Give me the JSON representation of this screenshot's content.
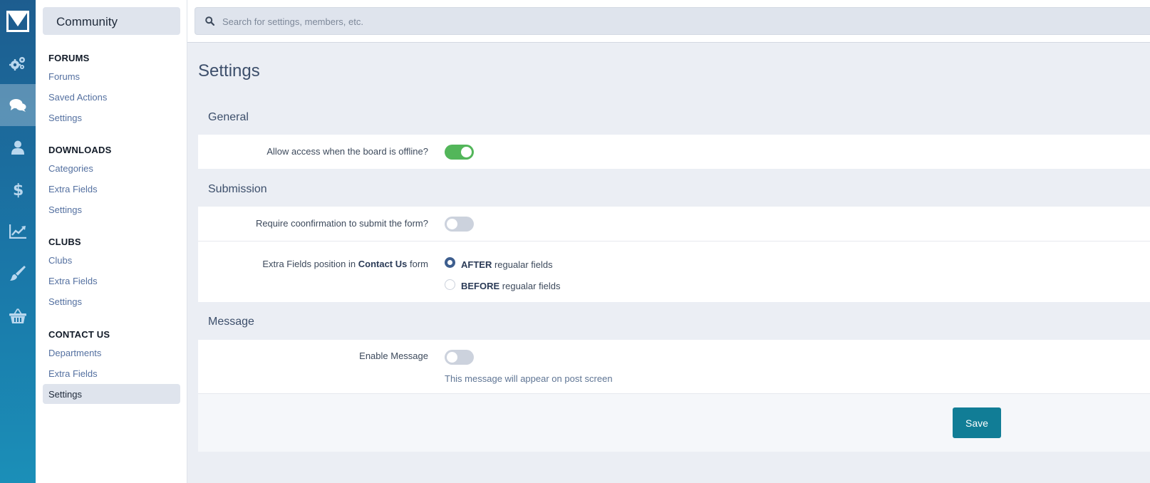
{
  "colors": {
    "accent": "#117d96",
    "toggle_on": "#53b65a",
    "rail": "#1d5d8f"
  },
  "rail": {
    "items": [
      {
        "icon": "gears-icon"
      },
      {
        "icon": "chat-bubbles-icon",
        "active": true
      },
      {
        "icon": "user-icon"
      },
      {
        "icon": "dollar-icon"
      },
      {
        "icon": "line-chart-icon"
      },
      {
        "icon": "paintbrush-icon"
      },
      {
        "icon": "basket-icon"
      }
    ]
  },
  "nav": {
    "title": "Community",
    "sections": [
      {
        "title": "FORUMS",
        "items": [
          "Forums",
          "Saved Actions",
          "Settings"
        ]
      },
      {
        "title": "DOWNLOADS",
        "items": [
          "Categories",
          "Extra Fields",
          "Settings"
        ]
      },
      {
        "title": "CLUBS",
        "items": [
          "Clubs",
          "Extra Fields",
          "Settings"
        ]
      },
      {
        "title": "CONTACT US",
        "items": [
          "Departments",
          "Extra Fields",
          "Settings"
        ]
      }
    ],
    "active_item": "CONTACT US > Settings"
  },
  "search": {
    "placeholder": "Search for settings, members, etc.",
    "value": ""
  },
  "page": {
    "title": "Settings",
    "groups": {
      "general": {
        "title": "General",
        "offline_label": "Allow access when the board is offline?",
        "offline_on": true
      },
      "submission": {
        "title": "Submission",
        "confirm_label": "Require coonfirmation to submit the form?",
        "confirm_on": false,
        "position_label_pre": "Extra Fields position in ",
        "position_label_bold": "Contact Us",
        "position_label_post": " form",
        "options": [
          {
            "bold": "AFTER",
            "rest": " regualar fields",
            "checked": true
          },
          {
            "bold": "BEFORE",
            "rest": " regualar fields",
            "checked": false
          }
        ]
      },
      "message": {
        "title": "Message",
        "enable_label": "Enable Message",
        "enable_on": false,
        "hint": "This message will appear on post screen"
      }
    },
    "save_label": "Save"
  }
}
